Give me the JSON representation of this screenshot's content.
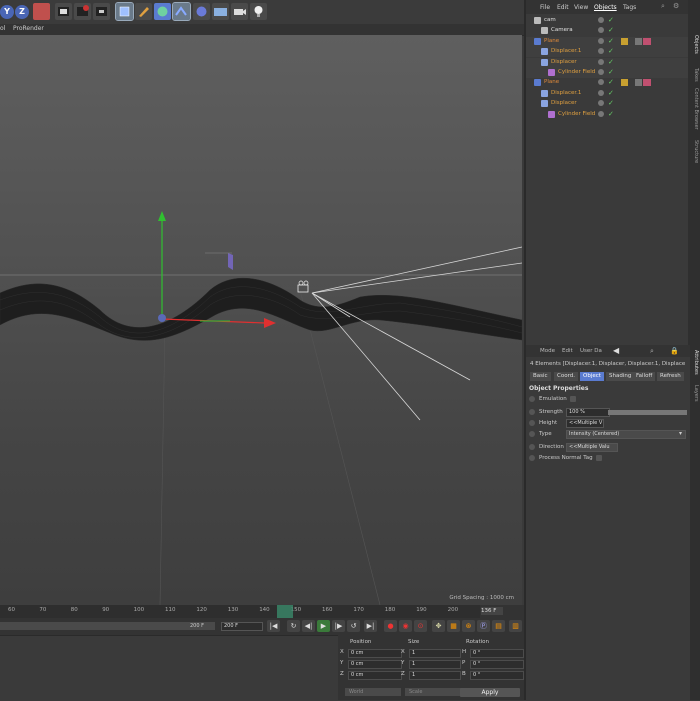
{
  "toolbar": {
    "axis_buttons": [
      "Y",
      "Z"
    ],
    "icons": [
      "undo-icon",
      "render-region-icon",
      "render-view-icon",
      "render-settings-icon",
      "cube-icon",
      "pen-icon",
      "subdivision-icon",
      "deformer-icon",
      "field-icon",
      "floor-icon",
      "camera-icon",
      "light-icon"
    ]
  },
  "viewport_menu": [
    "ol",
    "ProRender"
  ],
  "viewport": {
    "grid_spacing": "Grid Spacing : 1000 cm"
  },
  "object_manager": {
    "menu": [
      "File",
      "Edit",
      "View",
      "Objects",
      "Tags"
    ],
    "active_menu": "Objects",
    "rows": [
      {
        "label": "cam",
        "color": "#e0e0e0",
        "indent": 0,
        "icon_color": "#bbbbbb"
      },
      {
        "label": "Camera",
        "color": "#e0e0e0",
        "indent": 1,
        "icon_color": "#bbbbbb"
      },
      {
        "label": "Plane",
        "color": "#e08a3a",
        "indent": 0,
        "icon_color": "#5a7bd0"
      },
      {
        "label": "Displacer.1",
        "color": "#e0a040",
        "indent": 1,
        "icon_color": "#8aa4e0"
      },
      {
        "label": "Displacer",
        "color": "#e0a040",
        "indent": 1,
        "icon_color": "#8aa4e0"
      },
      {
        "label": "Cylinder Field",
        "color": "#e0a040",
        "indent": 2,
        "icon_color": "#b070d0"
      },
      {
        "label": "Plane",
        "color": "#e08a3a",
        "indent": 0,
        "icon_color": "#5a7bd0"
      },
      {
        "label": "Displacer.1",
        "color": "#e0a040",
        "indent": 1,
        "icon_color": "#8aa4e0"
      },
      {
        "label": "Displacer",
        "color": "#e0a040",
        "indent": 1,
        "icon_color": "#8aa4e0"
      },
      {
        "label": "Cylinder Field",
        "color": "#e0a040",
        "indent": 2,
        "icon_color": "#b070d0"
      }
    ]
  },
  "side_tabs_top": [
    "Objects",
    "Takes",
    "Content Browser",
    "Structure"
  ],
  "side_tabs_bottom": [
    "Attributes",
    "Layers"
  ],
  "attributes": {
    "menu": [
      "Mode",
      "Edit",
      "User Da"
    ],
    "header": "4 Elements [Displacer.1, Displacer, Displacer.1, Displace",
    "tabs": [
      "Basic",
      "Coord.",
      "Object",
      "Shading",
      "Falloff",
      "Refresh"
    ],
    "active_tab": "Object",
    "section": "Object Properties",
    "emulation_label": "Emulation",
    "strength_label": "Strength",
    "strength_value": "100 %",
    "height_label": "Height",
    "height_value": "<<Multiple V",
    "type_label": "Type",
    "type_value": "Intensity (Centered)",
    "direction_label": "Direction",
    "direction_value": "<<Multiple Valu",
    "process_normal_label": "Process Normal Tag"
  },
  "timeline": {
    "ticks": [
      "60",
      "70",
      "80",
      "90",
      "100",
      "110",
      "120",
      "130",
      "140",
      "150",
      "160",
      "170",
      "180",
      "190",
      "200"
    ],
    "current_frame": "136 F",
    "start_frame": "200 F",
    "end_frame": "200 F",
    "coord_headers": [
      "Position",
      "Size",
      "Rotation"
    ],
    "rows": [
      {
        "axis": "X",
        "pos": "0 cm",
        "size_axis": "X",
        "size": "1",
        "rot_axis": "H",
        "rot": "0 °"
      },
      {
        "axis": "Y",
        "pos": "0 cm",
        "size_axis": "Y",
        "size": "1",
        "rot_axis": "P",
        "rot": "0 °"
      },
      {
        "axis": "Z",
        "pos": "0 cm",
        "size_axis": "Z",
        "size": "1",
        "rot_axis": "B",
        "rot": "0 °"
      }
    ],
    "world_label": "World",
    "scale_label": "Scale",
    "apply_label": "Apply"
  },
  "colors": {
    "accent": "#5a7bd0",
    "object_orange": "#e0a040",
    "axis_x": "#e03030",
    "axis_y": "#30c030"
  }
}
